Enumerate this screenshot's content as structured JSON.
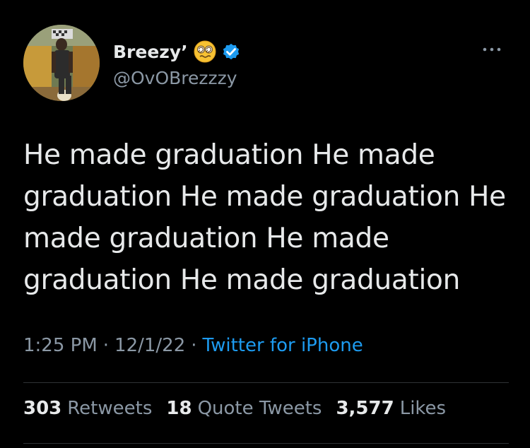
{
  "author": {
    "display_name": "Breezy’",
    "emoji": "woozy-face-emoji",
    "verified": true,
    "handle": "@OvOBrezzzy"
  },
  "tweet": {
    "text": "He made graduation He made graduation He made graduation He made graduation He made graduation He made graduation",
    "time": "1:25 PM",
    "date": "12/1/22",
    "source": "Twitter for iPhone"
  },
  "stats": {
    "retweets_count": "303",
    "retweets_label": "Retweets",
    "quote_count": "18",
    "quote_label": "Quote Tweets",
    "likes_count": "3,577",
    "likes_label": "Likes"
  },
  "icons": {
    "more": "more-dots-icon",
    "verified": "verified-badge-icon"
  },
  "colors": {
    "background": "#000000",
    "text": "#e7e9ea",
    "muted": "#8b98a5",
    "accent": "#1d9bf0",
    "divider": "#2f3336"
  }
}
